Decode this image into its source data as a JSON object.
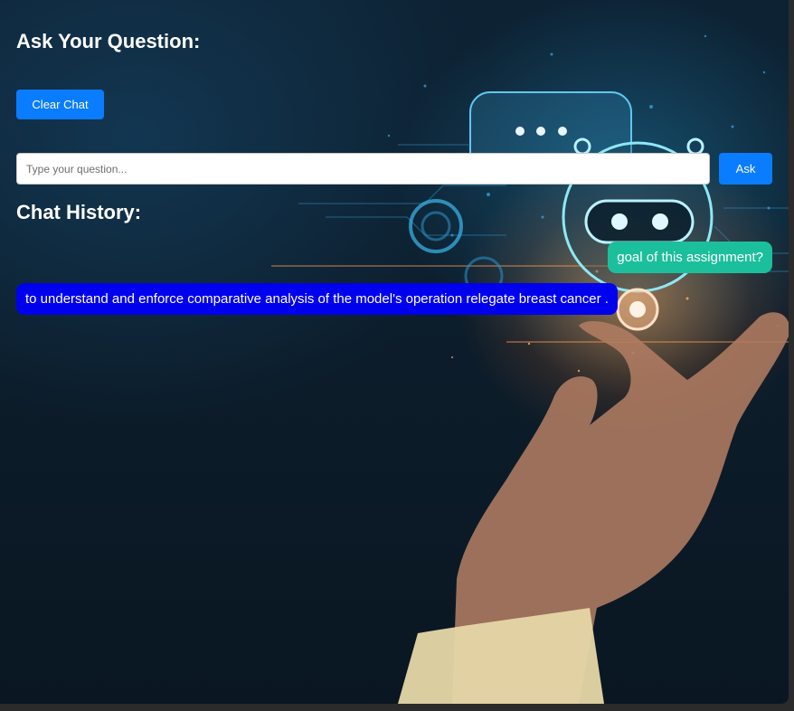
{
  "header": {
    "title": "Ask Your Question:"
  },
  "controls": {
    "clear_label": "Clear Chat",
    "ask_label": "Ask",
    "input_placeholder": "Type your question...",
    "input_value": ""
  },
  "history": {
    "title": "Chat History:",
    "messages": [
      {
        "role": "user",
        "text": "goal of this assignment?"
      },
      {
        "role": "bot",
        "text": "to understand and enforce comparative analysis of the model's operation relegate breast cancer ."
      }
    ]
  },
  "colors": {
    "button": "#0a7cff",
    "user_bubble": "#1cbf9b",
    "bot_bubble": "#0000ee",
    "background": "#0c1d2b"
  },
  "background_image": {
    "depicts": "robot-head-hand-tech-illustration"
  }
}
